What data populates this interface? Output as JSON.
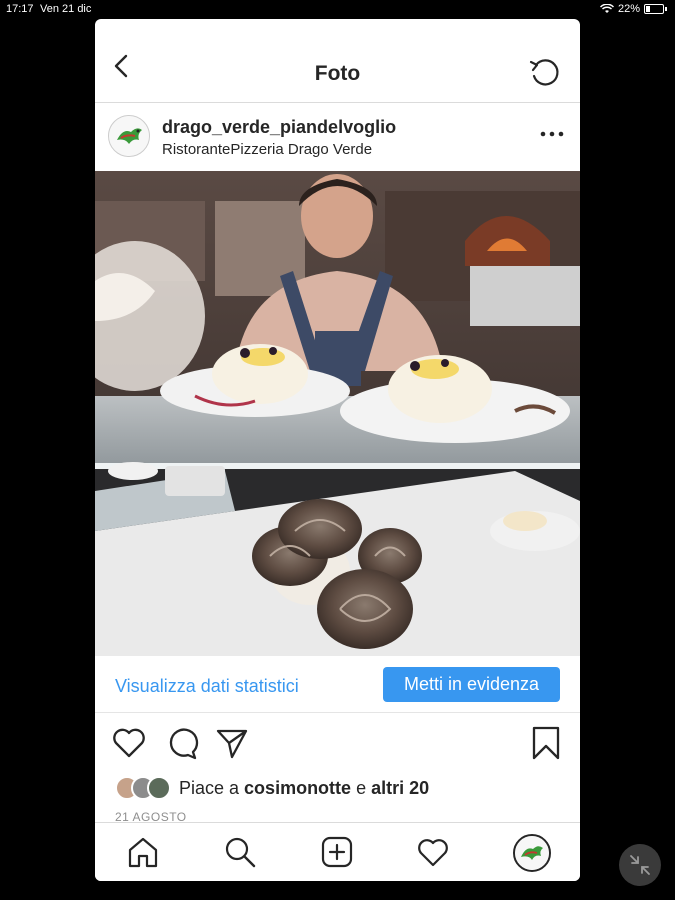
{
  "status_bar": {
    "time": "17:17",
    "date": "Ven 21 dic",
    "battery": "22%"
  },
  "nav": {
    "title": "Foto",
    "back_icon": "chevron-left-icon",
    "refresh_icon": "refresh-icon"
  },
  "post": {
    "username": "drago_verde_piandelvoglio",
    "location": "RistorantePizzeria Drago Verde",
    "insights_label": "Visualizza dati statistici",
    "promote_label": "Metti in evidenza",
    "likes_prefix": "Piace a ",
    "liker_name": "cosimonotte",
    "likes_and": " e ",
    "likes_others": "altri 20",
    "date": "21 AGOSTO"
  },
  "tabbar": {
    "items": [
      "home-icon",
      "search-icon",
      "new-post-icon",
      "activity-icon",
      "profile-avatar"
    ]
  },
  "colors": {
    "accent": "#3897f0",
    "text": "#262626",
    "muted": "#8e8e8e"
  }
}
